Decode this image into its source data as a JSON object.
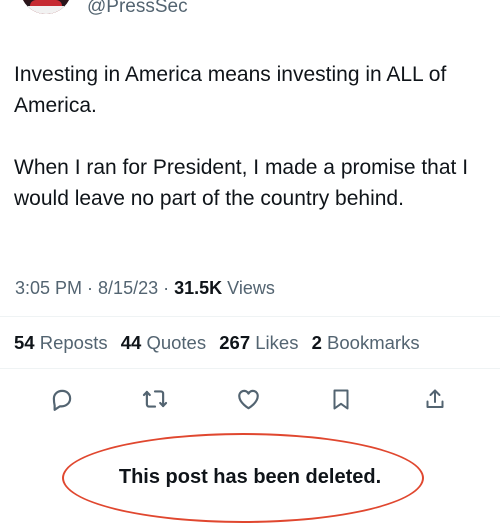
{
  "account": {
    "handle": "@PressSec"
  },
  "post": {
    "paragraphs": [
      "Investing in America means investing in ALL of America.",
      "When I ran for President, I made a promise that I would leave no part of the country behind."
    ],
    "time": "3:05 PM",
    "date": "8/15/23",
    "views_count": "31.5K",
    "views_label": "Views"
  },
  "stats": {
    "reposts": {
      "count": "54",
      "label": "Reposts"
    },
    "quotes": {
      "count": "44",
      "label": "Quotes"
    },
    "likes": {
      "count": "267",
      "label": "Likes"
    },
    "bookmarks": {
      "count": "2",
      "label": "Bookmarks"
    }
  },
  "actions": [
    {
      "icon": "reply-icon"
    },
    {
      "icon": "repost-icon"
    },
    {
      "icon": "like-icon"
    },
    {
      "icon": "bookmark-icon"
    },
    {
      "icon": "share-icon"
    }
  ],
  "notice": {
    "text": "This post has been deleted.",
    "highlight_color": "#e0472f"
  }
}
